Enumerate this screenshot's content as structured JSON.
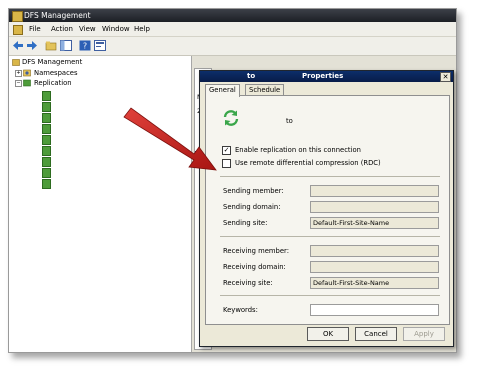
{
  "window": {
    "title": "DFS Management"
  },
  "menu": [
    "File",
    "Action",
    "View",
    "Window",
    "Help"
  ],
  "tree": {
    "root": "DFS Management",
    "namespaces": "Namespaces",
    "replication": "Replication",
    "group_count": 9
  },
  "right_pane": {
    "frag1": "Me",
    "frag2": "2"
  },
  "dialog": {
    "title_left": "to",
    "title_right": "Properties",
    "tabs": [
      "General",
      "Schedule"
    ],
    "header_to": "to",
    "enable_replication_label": "Enable replication on this connection",
    "enable_replication_checked": true,
    "rdc_label": "Use remote differential compression (RDC)",
    "rdc_checked": false,
    "sending_member_label": "Sending member:",
    "sending_member_value": "",
    "sending_domain_label": "Sending domain:",
    "sending_domain_value": "",
    "sending_site_label": "Sending site:",
    "sending_site_value": "Default-First-Site-Name",
    "receiving_member_label": "Receiving member:",
    "receiving_member_value": "",
    "receiving_domain_label": "Receiving domain:",
    "receiving_domain_value": "",
    "receiving_site_label": "Receiving site:",
    "receiving_site_value": "Default-First-Site-Name",
    "keywords_label": "Keywords:",
    "keywords_value": "",
    "ok_label": "OK",
    "cancel_label": "Cancel",
    "apply_label": "Apply"
  },
  "colors": {
    "arrow": "#c8201c",
    "title_bar": "#0c2e6a",
    "sync_icon": "#3aa64a"
  }
}
